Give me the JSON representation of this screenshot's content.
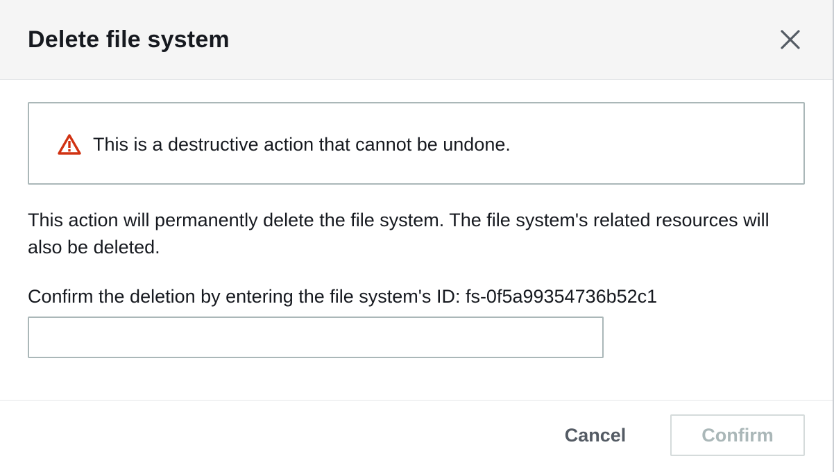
{
  "modal": {
    "title": "Delete file system",
    "close_icon": "close-icon"
  },
  "alert": {
    "icon": "warning-triangle-icon",
    "icon_color": "#d13212",
    "text": "This is a destructive action that cannot be undone."
  },
  "body": {
    "description": "This action will permanently delete the file system. The file system's related resources will also be deleted.",
    "confirm_label": "Confirm the deletion by entering the file system's ID: fs-0f5a99354736b52c1",
    "input_value": "",
    "input_placeholder": ""
  },
  "footer": {
    "cancel_label": "Cancel",
    "confirm_label": "Confirm",
    "confirm_disabled": true
  },
  "colors": {
    "header_bg": "#f5f5f5",
    "border": "#aab7b8",
    "text": "#16191f",
    "muted_button_text": "#545b64",
    "disabled_text": "#aab7b8"
  }
}
